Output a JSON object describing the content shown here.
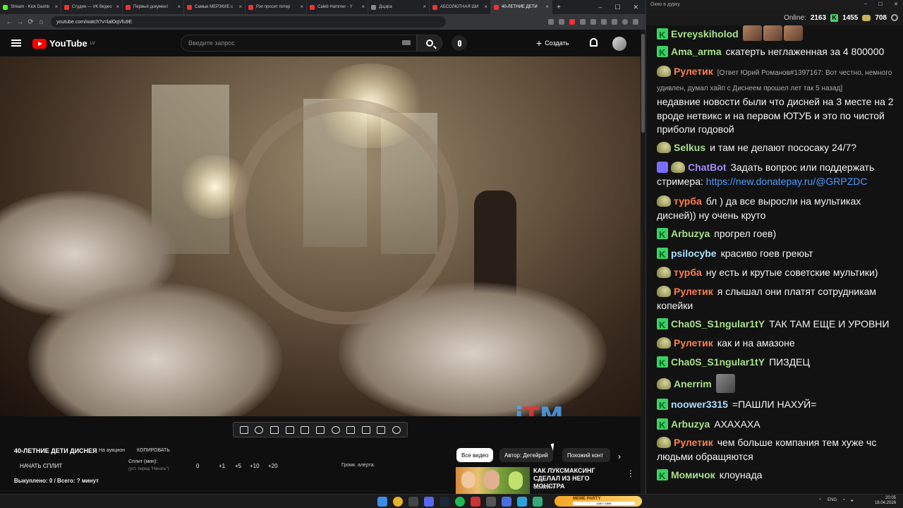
{
  "browser": {
    "tabs": [
      {
        "title": "Stream - Kick Dashb",
        "color": "#53fc18"
      },
      {
        "title": "Студия — VK Видео",
        "color": "#e33"
      },
      {
        "title": "Первый документ",
        "color": "#e33"
      },
      {
        "title": "Самые МЕРЗКИЕ с",
        "color": "#e33"
      },
      {
        "title": "Рэп просит потер",
        "color": "#e33"
      },
      {
        "title": "Caleb Hammer - Y",
        "color": "#e33"
      },
      {
        "title": "Дщэра",
        "color": "#888"
      },
      {
        "title": "АБСОЛЮТНАЯ ШИ",
        "color": "#e33"
      },
      {
        "title": "40-ЛЕТНИЕ ДЕТИ",
        "color": "#e33"
      }
    ],
    "url": "youtube.com/watch?v=lalOqVfu9E"
  },
  "youtube": {
    "logo": "YouTube",
    "region": "LV",
    "search_placeholder": "Введите запрос",
    "create_label": "Создать",
    "video_watermark": "iTM"
  },
  "below_video": {
    "title": "40-ЛЕТНИЕ ДЕТИ ДИСНЕЯ",
    "auction": "На аукцион",
    "copy": "КОПИРОВАТЬ",
    "start_split": "НАЧАТЬ СПЛИТ",
    "split_label": "Сплит (мин):",
    "split_hint": "(уст. перед \"Начать\")",
    "split_value": "0",
    "adjust": [
      "+1",
      "+5",
      "+10",
      "+20"
    ],
    "alert_label": "Громк. алерта:",
    "bought": "Выкуплено: 0 / Всего: ? минут",
    "chips": [
      "Все видео",
      "Автор: Детейрий",
      "Похожий конт"
    ],
    "rec_title": "КАК ЛУКСМАКСИНГ СДЕЛАЛ ИЗ НЕГО МОНСТРА",
    "rec_channel": "CONWAY"
  },
  "chat": {
    "window_title": "Окно в дурку",
    "online_label": "Online:",
    "online_value": "2163",
    "k_count": "1455",
    "coin_count": "708",
    "messages": [
      {
        "badge": "k",
        "nick": "Evreyskiholod",
        "color": "#a8e08a",
        "text": "",
        "emotes": 3
      },
      {
        "badge": "k",
        "nick": "Ama_arma",
        "color": "#a8e08a",
        "text": "скатерть неглаженная за 4 800000"
      },
      {
        "badge": "p",
        "nick": "Рулетик",
        "color": "#ff7f50",
        "reply": "[Ответ Юрий Романов#1397167: Вот честно, немного удивлен, думал хайп с Диснеем прошел лет так 5 назад]",
        "text": "недавние новости были что дисней на 3 месте на 2 вроде нетвикс и на первом ЮТУБ и это по чистой приболи годовой"
      },
      {
        "badge": "p",
        "nick": "Selkus",
        "color": "#a8e08a",
        "text": "и там не делают пососаку 24/7?"
      },
      {
        "badge": "bot",
        "nick": "ChatBot",
        "color": "#a48bff",
        "text": "Задать вопрос или поддержать стримера:",
        "link": "https://new.donatepay.ru/@GRPZDC"
      },
      {
        "badge": "p",
        "nick": "турба",
        "color": "#ff7f50",
        "text": "бл ) да все выросли на мультиках дисней)) ну очень круто"
      },
      {
        "badge": "k",
        "nick": "Arbuzya",
        "color": "#a8e08a",
        "text": "прогрел гоев)"
      },
      {
        "badge": "k",
        "nick": "psilocybe",
        "color": "#a8e0ff",
        "text": "красиво гоев греюьт"
      },
      {
        "badge": "p",
        "nick": "турба",
        "color": "#ff7f50",
        "text": "ну есть и крутые советские мультики)"
      },
      {
        "badge": "p",
        "nick": "Рулетик",
        "color": "#ff7f50",
        "text": "я слышал они платят сотрудникам копейки"
      },
      {
        "badge": "k",
        "nick": "Cha0S_S1ngular1tY",
        "color": "#a8e08a",
        "text": "ТАК ТАМ ЕЩЕ И УРОВНИ"
      },
      {
        "badge": "p",
        "nick": "Рулетик",
        "color": "#ff7f50",
        "text": "как и на амазоне"
      },
      {
        "badge": "k",
        "nick": "Cha0S_S1ngular1tY",
        "color": "#a8e08a",
        "text": "ПИЗДЕЦ"
      },
      {
        "badge": "p",
        "nick": "Anerrim",
        "color": "#a8e08a",
        "text": "",
        "emote_big": true
      },
      {
        "badge": "k",
        "nick": "noower3315",
        "color": "#a8e0ff",
        "text": "=ПАШЛИ НАХУЙ="
      },
      {
        "badge": "k",
        "nick": "Arbuzya",
        "color": "#a8e08a",
        "text": "АХАХАХА"
      },
      {
        "badge": "p",
        "nick": "Рулетик",
        "color": "#ff7f50",
        "text": "чем больше компания тем хуже чс людьми обращяются"
      },
      {
        "badge": "k",
        "nick": "Момичок",
        "color": "#a8e08a",
        "text": "клоунада"
      }
    ]
  },
  "taskbar": {
    "promo": "MEME PARTY",
    "promo_progress": "1337 / 1000",
    "lang": "ENG",
    "time": "20:05",
    "date": "18.04.2026"
  }
}
